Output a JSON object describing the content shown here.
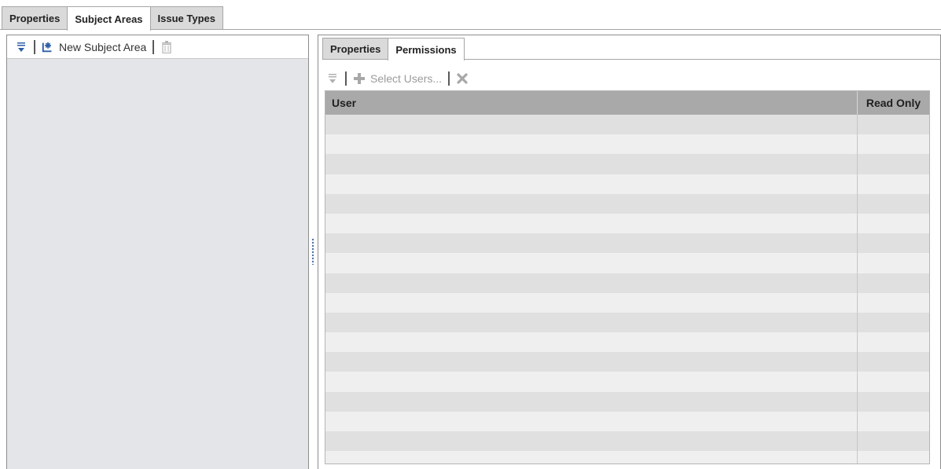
{
  "top_tabs": [
    {
      "label": "Properties",
      "active": false
    },
    {
      "label": "Subject Areas",
      "active": true
    },
    {
      "label": "Issue Types",
      "active": false
    }
  ],
  "left_toolbar": {
    "new_label": "New Subject Area",
    "icons": [
      "filter-icon",
      "new-subject-area-icon",
      "trash-icon"
    ]
  },
  "right_tabs": [
    {
      "label": "Properties",
      "active": false
    },
    {
      "label": "Permissions",
      "active": true
    }
  ],
  "right_toolbar": {
    "select_label": "Select Users...",
    "icons": [
      "filter-icon",
      "plus-icon",
      "delete-x-icon"
    ]
  },
  "grid": {
    "columns": [
      "User",
      "Read Only"
    ],
    "rows": []
  },
  "colors": {
    "accent_blue": "#2d5fa8",
    "header_gray": "#a9a9a9",
    "panel_bg": "#e4e5e9"
  }
}
